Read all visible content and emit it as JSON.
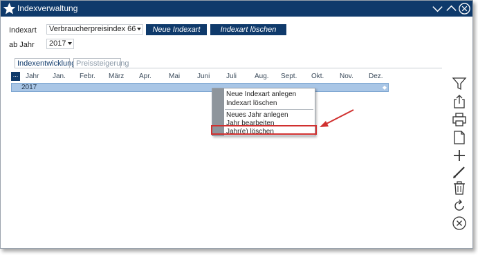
{
  "window": {
    "title": "Indexverwaltung"
  },
  "form": {
    "indexart_label": "Indexart",
    "indexart_value": "Verbraucherpreisindex 66",
    "ab_jahr_label": "ab Jahr",
    "ab_jahr_value": "2017",
    "new_button": "Neue Indexart",
    "delete_button": "Indexart löschen"
  },
  "tabs": [
    {
      "label": "Indexentwicklung",
      "active": true
    },
    {
      "label": "Preissteigerung",
      "active": false
    }
  ],
  "table": {
    "menu_button": "...",
    "columns": [
      "Jahr",
      "Jan.",
      "Febr.",
      "März",
      "Apr.",
      "Mai",
      "Juni",
      "Juli",
      "Aug.",
      "Sept.",
      "Okt.",
      "Nov.",
      "Dez."
    ],
    "rows": [
      {
        "jahr": "2017"
      }
    ],
    "row_end_glyph": "◆"
  },
  "context_menu": {
    "items": [
      "Neue Indexart anlegen",
      "Indexart löschen",
      "Neues Jahr anlegen",
      "Jahr bearbeiten",
      "Jahr(e) löschen"
    ],
    "highlighted": "Jahr(e) löschen"
  },
  "sidebar_icons": [
    "filter-icon",
    "export-icon",
    "print-icon",
    "document-icon",
    "add-icon",
    "edit-icon",
    "delete-icon",
    "refresh-icon",
    "close-icon"
  ],
  "colors": {
    "titlebar": "#0f3a6b",
    "accent": "#0f3a6b",
    "row_selected": "#a9c6e6",
    "highlight": "#d0302f"
  }
}
